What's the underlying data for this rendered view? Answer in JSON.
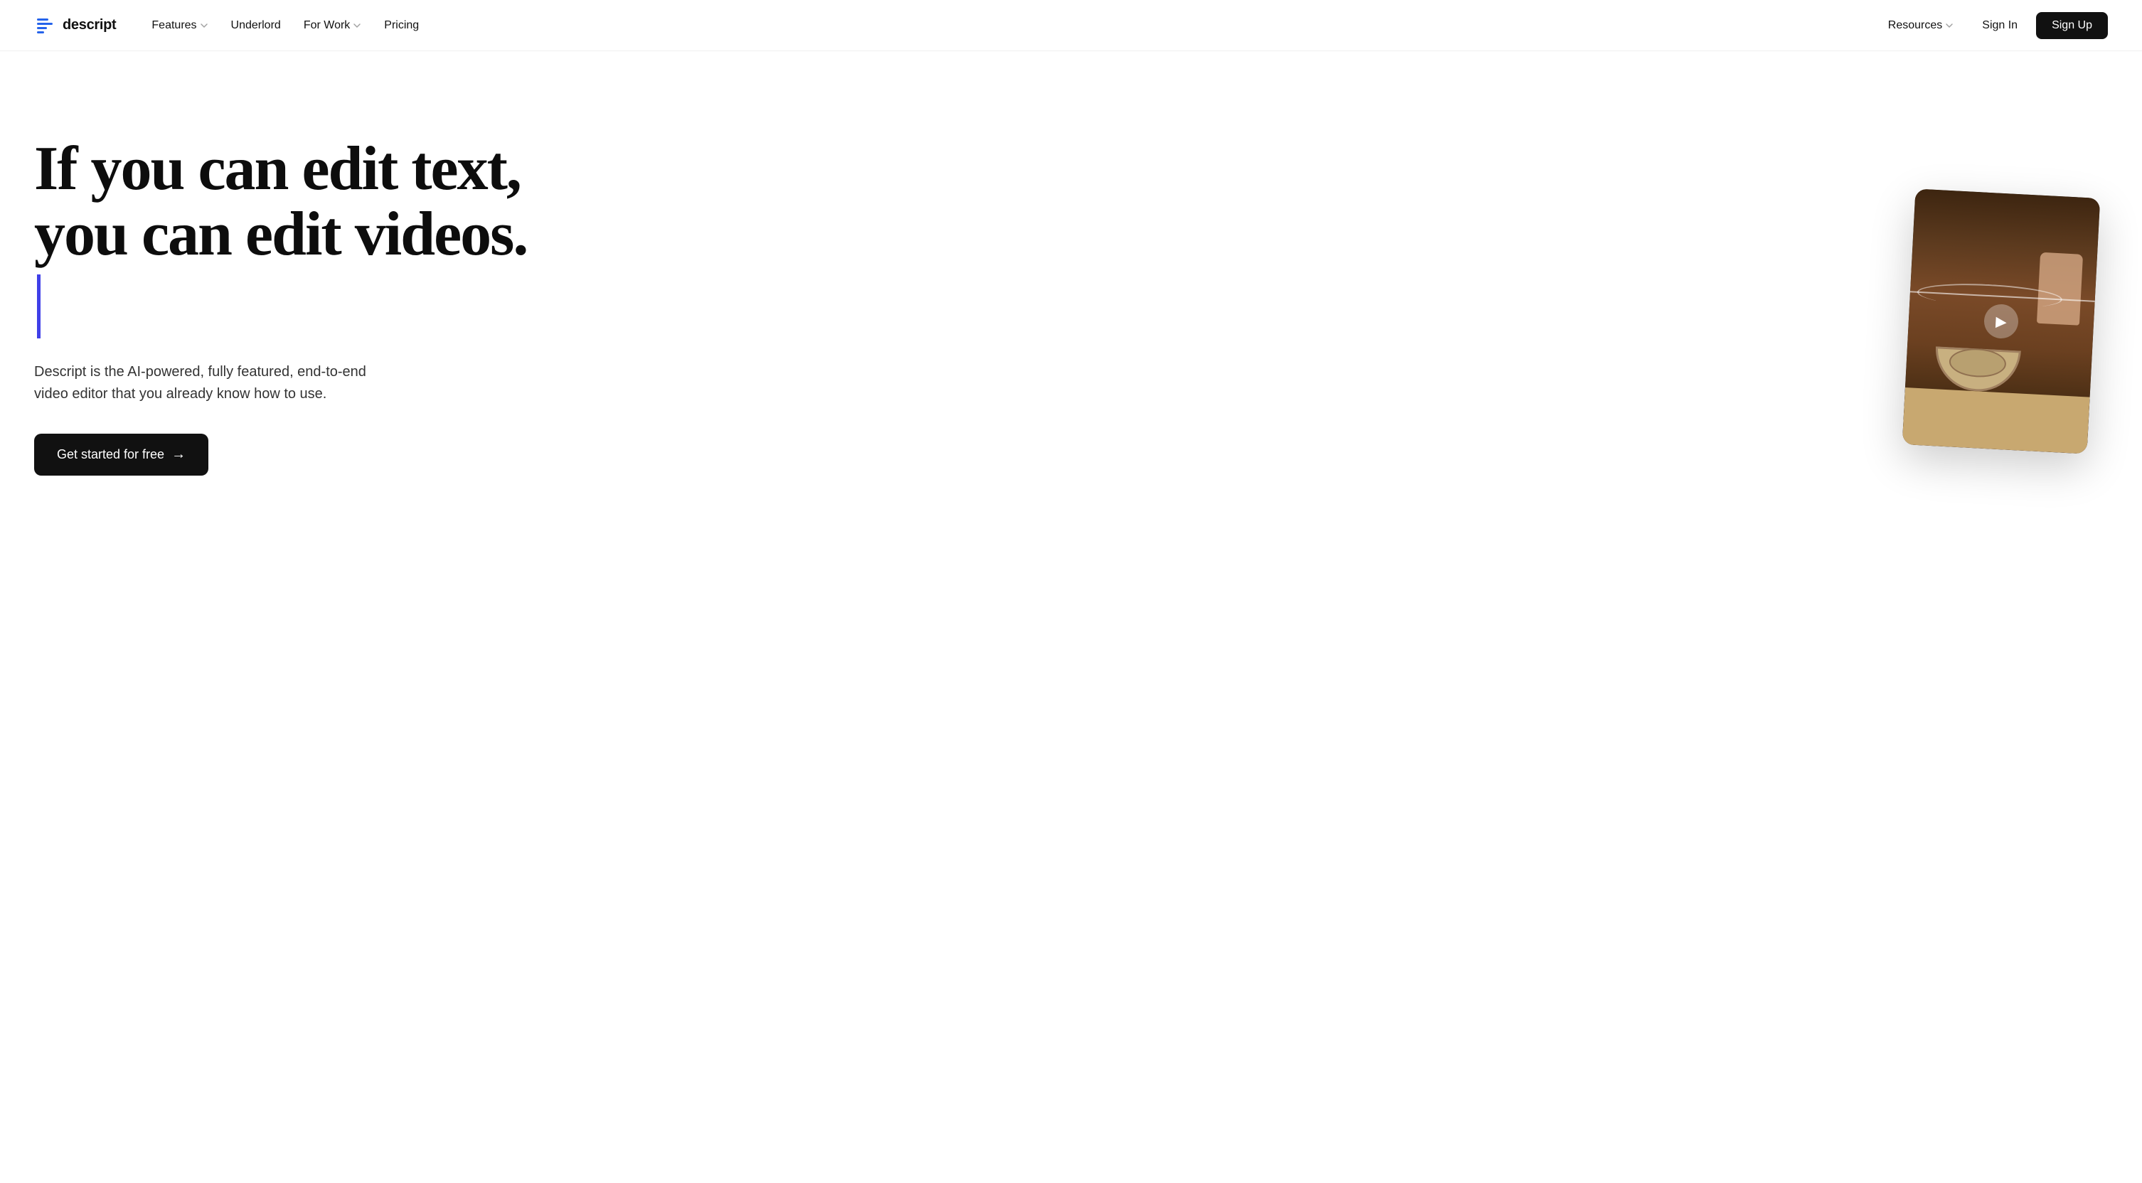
{
  "nav": {
    "logo_text": "descript",
    "links": [
      {
        "label": "Features",
        "has_dropdown": true
      },
      {
        "label": "Underlord",
        "has_dropdown": false
      },
      {
        "label": "For Work",
        "has_dropdown": true
      },
      {
        "label": "Pricing",
        "has_dropdown": false
      }
    ],
    "right_links": [
      {
        "label": "Resources",
        "has_dropdown": true
      }
    ],
    "sign_in_label": "Sign In",
    "sign_up_label": "Sign Up"
  },
  "hero": {
    "title_line1": "If you can edit text,",
    "title_line2": "you can edit videos.",
    "subtitle": "Descript is the AI-powered, fully featured, end-to-end video editor that you already know how to use.",
    "cta_label": "Get started for free",
    "cta_arrow": "→"
  },
  "colors": {
    "cursor": "#4040e8",
    "cta_bg": "#111111",
    "nav_bg": "#ffffff"
  }
}
